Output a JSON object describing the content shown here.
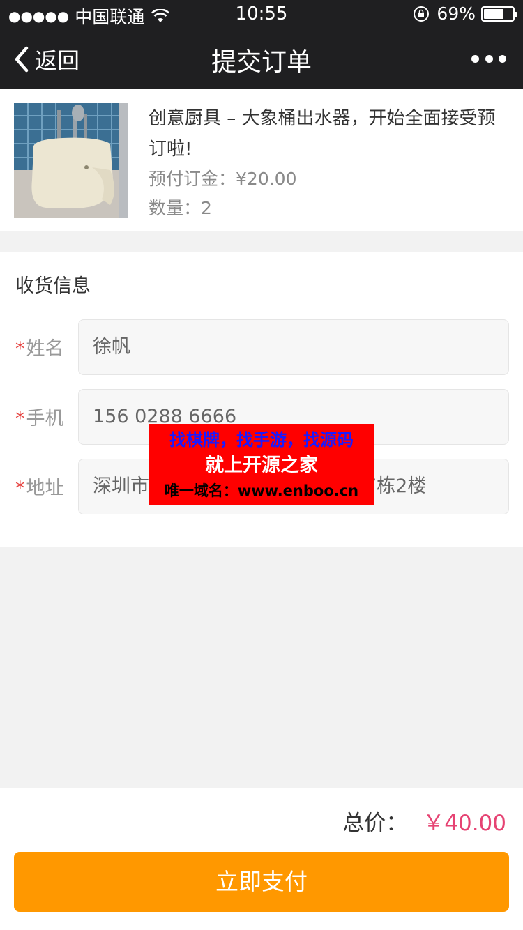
{
  "status_bar": {
    "signal_dots": "●●●●●",
    "carrier": "中国联通",
    "time": "10:55",
    "battery_percent": "69%",
    "battery_level": 0.69,
    "icons": [
      "signal-dots-icon",
      "wifi-icon",
      "orientation-lock-icon",
      "battery-icon"
    ]
  },
  "nav": {
    "back_label": "返回",
    "title": "提交订单",
    "more_icon": "more-dots-icon"
  },
  "product": {
    "name": "创意厨具 – 大象桶出水器，开始全面接受预订啦!",
    "deposit_label": "预付订金：",
    "deposit_value": "¥20.00",
    "qty_label": "数量：",
    "qty_value": "2"
  },
  "shipping": {
    "heading": "收货信息",
    "required_mark": "*",
    "name_label": "姓名",
    "name_value": "徐帆",
    "phone_label": "手机",
    "phone_value": "156 0288 6666",
    "address_label": "地址",
    "address_value": "深圳市                                  27栋2楼"
  },
  "overlay_ad": {
    "line1": "找棋牌，找手游，找源码",
    "line2": "就上开源之家",
    "line3": "唯一域名：www.enboo.cn"
  },
  "footer": {
    "total_label": "总价：",
    "total_value": "￥40.00",
    "pay_label": "立即支付"
  },
  "colors": {
    "header_bg": "#1f1f21",
    "accent_price": "#e64373",
    "pay_button": "#ff9800",
    "required_star": "#e64340"
  }
}
